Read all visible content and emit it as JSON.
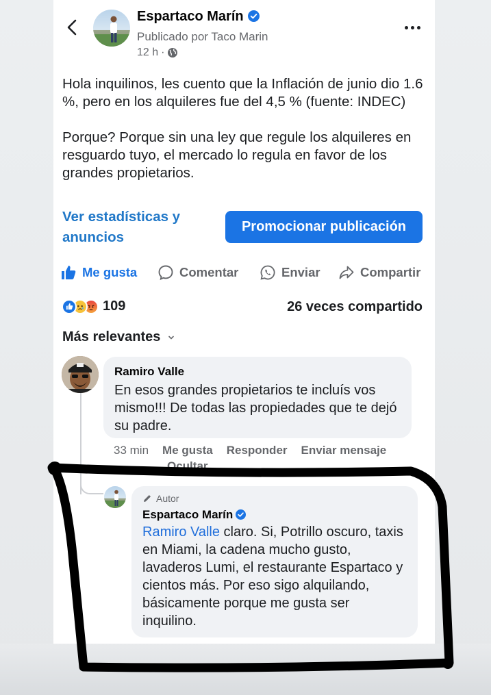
{
  "post": {
    "author_name": "Espartaco Marín",
    "published_by": "Publicado por Taco Marin",
    "time": "12 h",
    "separator": "·",
    "paragraphs": [
      "Hola inquilinos, les cuento que la Inflación de junio dio 1.6 %, pero en los alquileres fue del 4,5 % (fuente: INDEC)",
      "Porque? Porque sin una ley que regule los alquileres en resguardo tuyo, el mercado lo regula en favor de los grandes propietarios."
    ]
  },
  "links": {
    "stats": "Ver estadísticas y anuncios",
    "promote": "Promocionar publicación"
  },
  "actions": {
    "like": "Me gusta",
    "comment": "Comentar",
    "send": "Enviar",
    "share": "Compartir"
  },
  "engagement": {
    "reaction_count": "109",
    "shares": "26 veces compartido"
  },
  "comments": {
    "sort_label": "Más relevantes",
    "first": {
      "name": "Ramiro Valle",
      "text": "En esos grandes propietarios te incluís vos mismo!!! De todas las propiedades que te dejó su padre.",
      "time": "33 min",
      "like": "Me gusta",
      "reply": "Responder",
      "message": "Enviar mensaje",
      "hide": "Ocultar"
    },
    "reply": {
      "badge": "Autor",
      "name": "Espartaco Marín",
      "mention": "Ramiro Valle",
      "text": " claro. Si, Potrillo oscuro, taxis en Miami, la cadena mucho gusto, lavaderos Lumi, el restaurante Espartaco y cientos más. Por eso sigo alquilando, básicamente porque me gusta ser inquilino."
    }
  },
  "colors": {
    "brand_blue": "#1b74e4",
    "link_blue": "#2178c8",
    "secondary_text": "#65676b",
    "bubble": "#f0f2f5",
    "marker": "#000000"
  }
}
